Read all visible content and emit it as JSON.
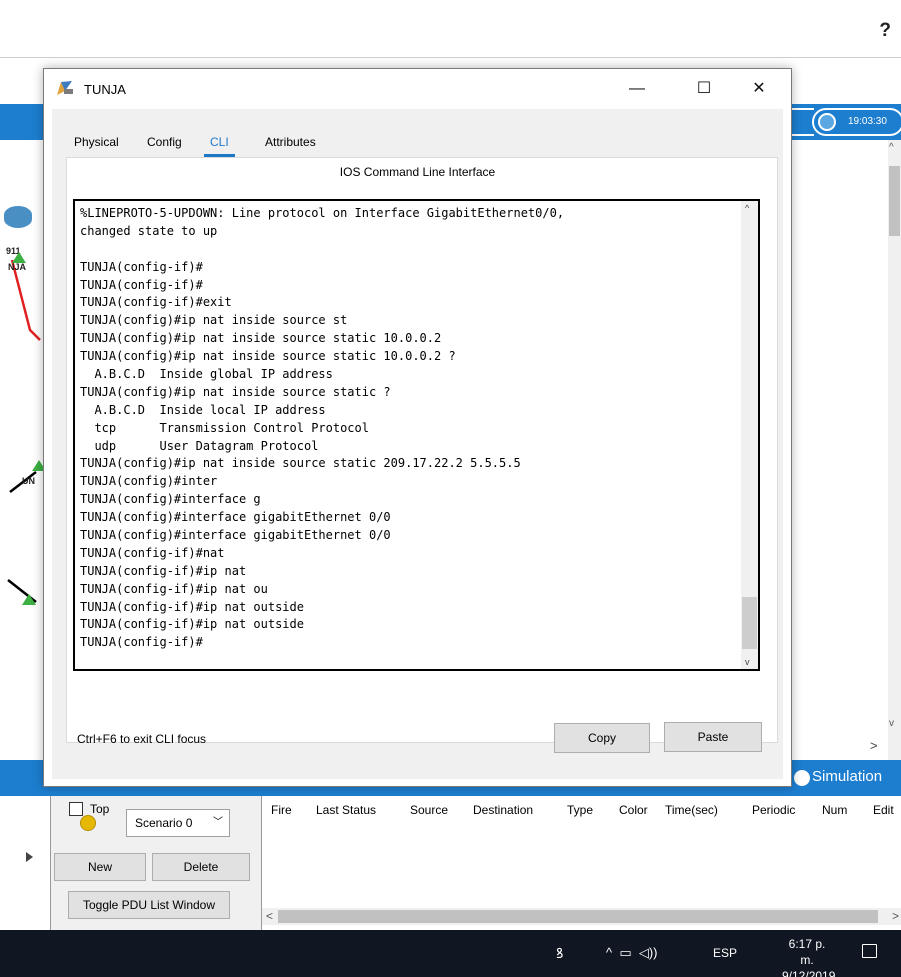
{
  "app": {
    "help_label": "?",
    "clock": "19:03:30",
    "node_labels": [
      "911",
      "NJA",
      "UN"
    ],
    "simulation_label": "Simulation"
  },
  "dialog": {
    "title": "TUNJA",
    "minimize": "—",
    "maximize": "☐",
    "close": "✕",
    "tabs": [
      {
        "label": "Physical"
      },
      {
        "label": "Config"
      },
      {
        "label": "CLI"
      },
      {
        "label": "Attributes"
      }
    ],
    "active_tab": "CLI",
    "panel_title": "IOS Command Line Interface",
    "cli_lines": [
      "%LINEPROTO-5-UPDOWN: Line protocol on Interface GigabitEthernet0/0,",
      "changed state to up",
      "",
      "TUNJA(config-if)#",
      "TUNJA(config-if)#",
      "TUNJA(config-if)#exit",
      "TUNJA(config)#ip nat inside source st",
      "TUNJA(config)#ip nat inside source static 10.0.0.2",
      "TUNJA(config)#ip nat inside source static 10.0.0.2 ?",
      "  A.B.C.D  Inside global IP address",
      "TUNJA(config)#ip nat inside source static ?",
      "  A.B.C.D  Inside local IP address",
      "  tcp      Transmission Control Protocol",
      "  udp      User Datagram Protocol",
      "TUNJA(config)#ip nat inside source static 209.17.22.2 5.5.5.5",
      "TUNJA(config)#inter",
      "TUNJA(config)#interface g",
      "TUNJA(config)#interface gigabitEthernet 0/0",
      "TUNJA(config)#interface gigabitEthernet 0/0",
      "TUNJA(config-if)#nat",
      "TUNJA(config-if)#ip nat",
      "TUNJA(config-if)#ip nat ou",
      "TUNJA(config-if)#ip nat outside",
      "TUNJA(config-if)#ip nat outside",
      "TUNJA(config-if)#"
    ],
    "focus_hint": "Ctrl+F6 to exit CLI focus",
    "copy_label": "Copy",
    "paste_label": "Paste",
    "top_label": "Top"
  },
  "pdu": {
    "scenario": "Scenario 0",
    "new_label": "New",
    "delete_label": "Delete",
    "toggle_label": "Toggle PDU List Window",
    "columns": [
      "Fire",
      "Last Status",
      "Source",
      "Destination",
      "Type",
      "Color",
      "Time(sec)",
      "Periodic",
      "Num",
      "Edit"
    ]
  },
  "taskbar": {
    "language": "ESP",
    "time": "6:17 p. m.",
    "date": "9/12/2019"
  },
  "colors": {
    "accent": "#1e78c8",
    "app_strip": "#1d7ed0",
    "taskbar": "#101622",
    "link_red": "#e02020",
    "node_green": "#3cb043"
  }
}
